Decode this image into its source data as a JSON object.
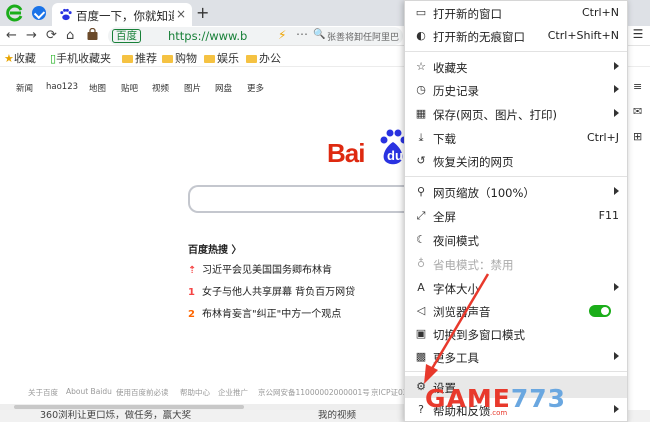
{
  "tabbar": {
    "tab_title": "百度一下，你就知道",
    "close_glyph": "×",
    "new_tab_glyph": "+"
  },
  "navbar": {
    "back_glyph": "←",
    "forward_glyph": "→",
    "reload_glyph": "⟳",
    "home_glyph": "⌂",
    "secure_label": "百度",
    "url": "https://www.b",
    "dots_glyph": "⋯",
    "hot_text": "张善将卸任阿里巴"
  },
  "bookmarks": {
    "items": [
      {
        "label": "收藏",
        "kind": "star"
      },
      {
        "label": "手机收藏夹",
        "kind": "phone"
      },
      {
        "label": "推荐",
        "kind": "folder"
      },
      {
        "label": "购物",
        "kind": "folder"
      },
      {
        "label": "娱乐",
        "kind": "folder"
      },
      {
        "label": "办公",
        "kind": "folder"
      }
    ]
  },
  "page": {
    "topnav": [
      "新闻",
      "hao123",
      "地图",
      "贴吧",
      "视频",
      "图片",
      "网盘",
      "更多"
    ],
    "logo_text": "Bai",
    "logo_du": "du",
    "hot_title": "百度热搜 〉",
    "hot_items": [
      {
        "rank": "⇡",
        "text": "习近平会见美国国务卿布林肯"
      },
      {
        "rank": "1",
        "text": "女子与他人共享屏幕 背负百万网贷"
      },
      {
        "rank": "2",
        "text": "布林肯妄言\"纠正\"中方一个观点"
      }
    ],
    "footer": [
      "关于百度",
      "About Baidu",
      "使用百度前必读",
      "帮助中心",
      "企业推广",
      "京公网安备11000002000001号",
      "京ICP证03"
    ]
  },
  "statusbar": {
    "left_text": "360浏利让更口烁，做任务，赢大奖",
    "right_text": "我的视频"
  },
  "menu": {
    "items": [
      {
        "icon": "▭",
        "label": "打开新的窗口",
        "shortcut": "Ctrl+N",
        "name": "menu-new-window"
      },
      {
        "icon": "◐",
        "label": "打开新的无痕窗口",
        "shortcut": "Ctrl+Shift+N",
        "name": "menu-new-incognito"
      },
      {
        "icon": "☆",
        "label": "收藏夹",
        "arrow": true,
        "name": "menu-favorites"
      },
      {
        "icon": "◷",
        "label": "历史记录",
        "arrow": true,
        "name": "menu-history"
      },
      {
        "icon": "▦",
        "label": "保存(网页、图片、打印)",
        "arrow": true,
        "name": "menu-save"
      },
      {
        "icon": "⤓",
        "label": "下载",
        "shortcut": "Ctrl+J",
        "name": "menu-download"
      },
      {
        "icon": "↺",
        "label": "恢复关闭的网页",
        "name": "menu-restore-closed"
      },
      {
        "icon": "⚲",
        "label": "网页缩放（100%）",
        "arrow": true,
        "name": "menu-zoom"
      },
      {
        "icon": "⤢",
        "label": "全屏",
        "shortcut": "F11",
        "name": "menu-fullscreen"
      },
      {
        "icon": "☾",
        "label": "夜间模式",
        "name": "menu-night-mode"
      },
      {
        "icon": "♁",
        "label": "省电模式：禁用",
        "disabled": true,
        "name": "menu-power-saving"
      },
      {
        "icon": "A",
        "label": "字体大小",
        "arrow": true,
        "name": "menu-font-size"
      },
      {
        "icon": "◁",
        "label": "浏览器声音",
        "toggle": true,
        "name": "menu-browser-sound"
      },
      {
        "icon": "▣",
        "label": "切换到多窗口模式",
        "name": "menu-multi-window"
      },
      {
        "icon": "▩",
        "label": "更多工具",
        "arrow": true,
        "name": "menu-more-tools"
      },
      {
        "icon": "⚙",
        "label": "设置",
        "name": "menu-settings",
        "highlight": true
      },
      {
        "icon": "?",
        "label": "帮助和反馈",
        "arrow": true,
        "name": "menu-help"
      }
    ],
    "browser_sound_on": true
  },
  "side": {
    "menu_glyph": "☰",
    "icons": [
      "≡",
      "✉",
      "⊞"
    ]
  },
  "watermark": {
    "game": "GAME",
    "num": "773",
    "suffix": ".com"
  },
  "colors": {
    "accent_green": "#1aad19",
    "baidu_red": "#de2910",
    "baidu_blue": "#2932e1",
    "url_green": "#188038",
    "annotation_red": "#e8392c"
  }
}
